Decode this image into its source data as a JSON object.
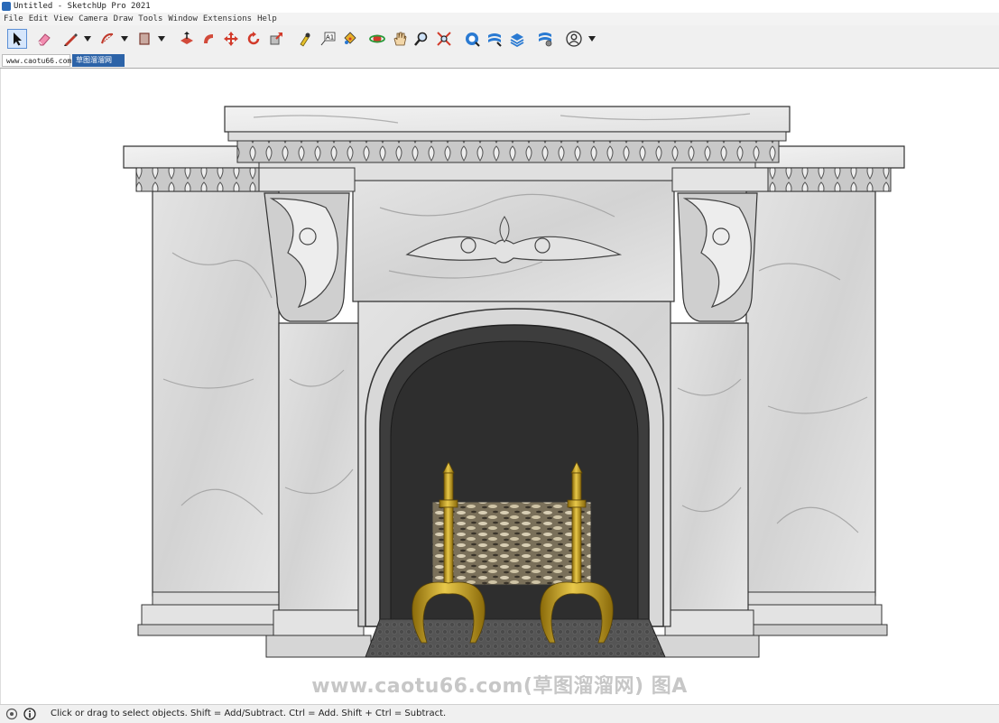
{
  "window": {
    "title": "Untitled - SketchUp Pro 2021"
  },
  "menu": [
    "File",
    "Edit",
    "View",
    "Camera",
    "Draw",
    "Tools",
    "Window",
    "Extensions",
    "Help"
  ],
  "toolbar": {
    "tools": [
      "select",
      "eraser",
      "line",
      "arc",
      "rectangle",
      "push-pull",
      "follow-me",
      "move",
      "rotate",
      "scale",
      "tape-measure",
      "text",
      "paint-bucket",
      "orbit",
      "pan",
      "zoom",
      "zoom-extents",
      "warehouse",
      "extension-warehouse",
      "layout",
      "extension-manager",
      "account"
    ],
    "active_tool": "select",
    "accent": "#5b8fd6"
  },
  "tabs": [
    {
      "label": "www.caotu66.com"
    },
    {
      "label": "草图溜溜网"
    }
  ],
  "viewport": {
    "background": "#ffffff"
  },
  "watermark": {
    "text": "www.caotu66.com(草图溜溜网) 图A"
  },
  "status": {
    "text": "Click or drag to select objects. Shift = Add/Subtract. Ctrl = Add. Shift + Ctrl = Subtract."
  }
}
